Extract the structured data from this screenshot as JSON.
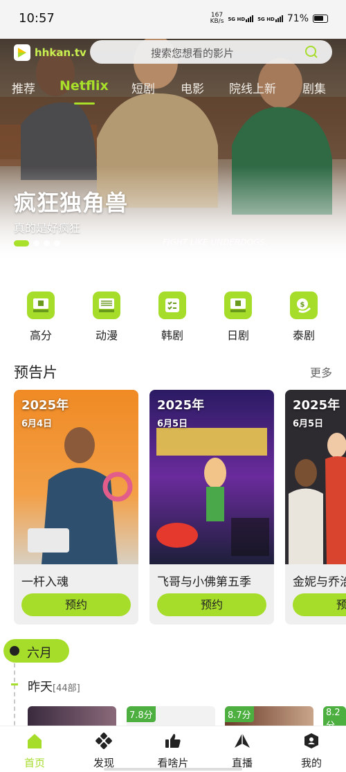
{
  "status_bar": {
    "time": "10:57",
    "net_speed_value": "167",
    "net_speed_unit": "KB/s",
    "signal_1": "5G HD",
    "signal_2": "5G HD",
    "battery": "71%"
  },
  "header": {
    "logo_text": "hhkan.tv",
    "search_placeholder": "搜索您想看的影片"
  },
  "category_tabs": [
    {
      "label": "推荐",
      "active": false
    },
    {
      "label": "Netflix",
      "active": true
    },
    {
      "label": "短剧",
      "active": false
    },
    {
      "label": "电影",
      "active": false
    },
    {
      "label": "院线上新",
      "active": false
    },
    {
      "label": "剧集",
      "active": false
    }
  ],
  "hero": {
    "title": "疯狂独角兽",
    "subtitle": "真的是好疯狂",
    "slide_count": 4,
    "active_slide": 1
  },
  "quick_categories": [
    {
      "label": "高分",
      "icon": "manga-icon"
    },
    {
      "label": "动漫",
      "icon": "manga-book-icon"
    },
    {
      "label": "韩剧",
      "icon": "checklist-icon"
    },
    {
      "label": "日剧",
      "icon": "netflix-tv-icon"
    },
    {
      "label": "泰剧",
      "icon": "coin-icon"
    }
  ],
  "trailers": {
    "title": "预告片",
    "more": "更多",
    "items": [
      {
        "year": "2025年",
        "date": "6月4日",
        "name": "一杆入魂",
        "button": "预约"
      },
      {
        "year": "2025年",
        "date": "6月5日",
        "name": "飞哥与小佛第五季",
        "button": "预约"
      },
      {
        "year": "2025年",
        "date": "6月5日",
        "name": "金妮与乔治",
        "button": "预约"
      }
    ]
  },
  "timeline": {
    "month": "六月",
    "day_label": "昨天",
    "day_count": "[44部]",
    "scores": [
      "7.8分",
      "8.7分",
      "8.2分"
    ]
  },
  "bottom_nav": [
    {
      "label": "首页",
      "icon": "home-icon",
      "active": true
    },
    {
      "label": "发现",
      "icon": "discover-icon",
      "active": false
    },
    {
      "label": "看啥片",
      "icon": "thumbs-up-icon",
      "active": false
    },
    {
      "label": "直播",
      "icon": "live-icon",
      "active": false
    },
    {
      "label": "我的",
      "icon": "profile-icon",
      "active": false
    }
  ],
  "colors": {
    "accent": "#a6dd2b",
    "score_badge": "#4caf3f"
  }
}
